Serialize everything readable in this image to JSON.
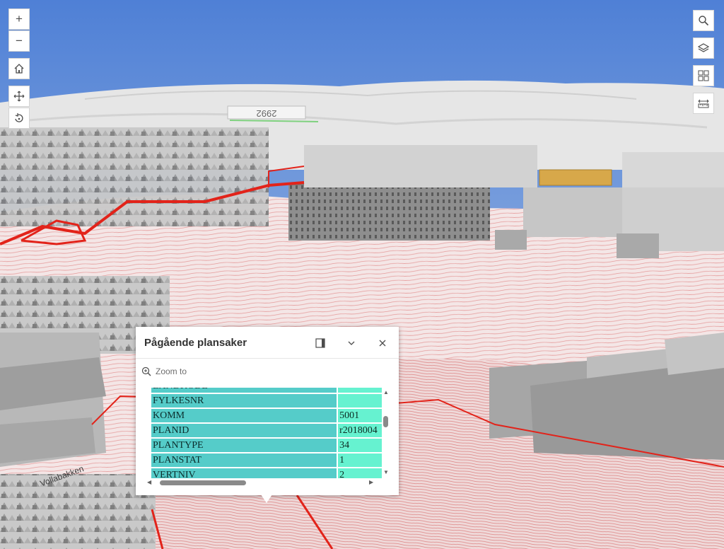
{
  "map_controls": {
    "zoom_in": "+",
    "zoom_out": "−",
    "home_icon": "home-icon",
    "pan_icon": "pan-icon",
    "rotate_icon": "rotate-icon"
  },
  "right_toolbar": [
    "search-icon",
    "layers-icon",
    "basemap-gallery-icon",
    "measure-icon"
  ],
  "map_labels": {
    "route_shield": "2992",
    "street_name": "Vollabakken"
  },
  "colors": {
    "sky": "#6d95d8",
    "plan_line": "#e2231a",
    "highlight_building": "#d7a84a",
    "table_key_bg": "#55ccc9",
    "table_value_bg": "#66f2d0"
  },
  "popup": {
    "title": "Pågående plansaker",
    "zoom_label": "Zoom to",
    "partial_top_row": "LANDKODE",
    "rows": [
      {
        "key": "FYLKESNR",
        "value": ""
      },
      {
        "key": "KOMM",
        "value": "5001"
      },
      {
        "key": "PLANID",
        "value": "r2018004"
      },
      {
        "key": "PLANTYPE",
        "value": "34"
      },
      {
        "key": "PLANSTAT",
        "value": "1"
      },
      {
        "key": "VERTNIV",
        "value": "2"
      }
    ]
  }
}
